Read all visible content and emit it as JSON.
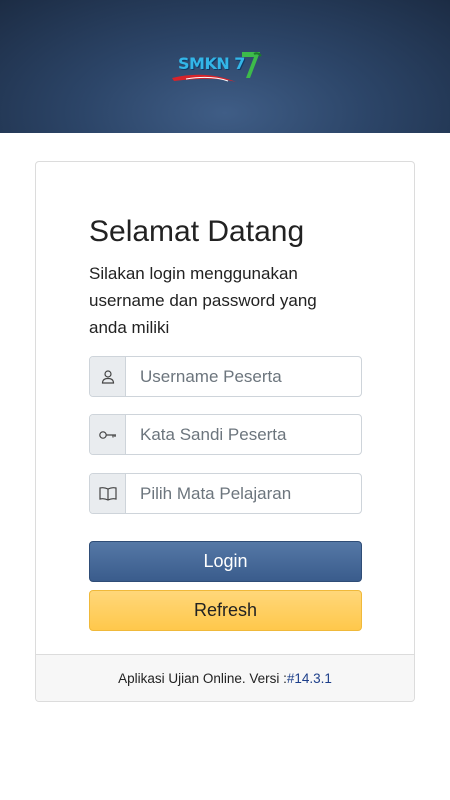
{
  "header": {
    "logo_text": "SMKN 7"
  },
  "login": {
    "title": "Selamat Datang",
    "subtitle": "Silakan login menggunakan username dan password yang anda miliki",
    "username_placeholder": "Username Peserta",
    "password_placeholder": "Kata Sandi Peserta",
    "subject_placeholder": "Pilih Mata Pelajaran",
    "login_label": "Login",
    "refresh_label": "Refresh"
  },
  "footer": {
    "app_text": "Aplikasi Ujian Online. Versi :",
    "version": "#14.3.1"
  },
  "colors": {
    "header_bg": "#2c4568",
    "login_button": "#3a5c8c",
    "refresh_button": "#ffc84b",
    "version_link": "#1d3f8a"
  },
  "icons": {
    "username": "user-icon",
    "password": "key-icon",
    "subject": "book-icon"
  }
}
